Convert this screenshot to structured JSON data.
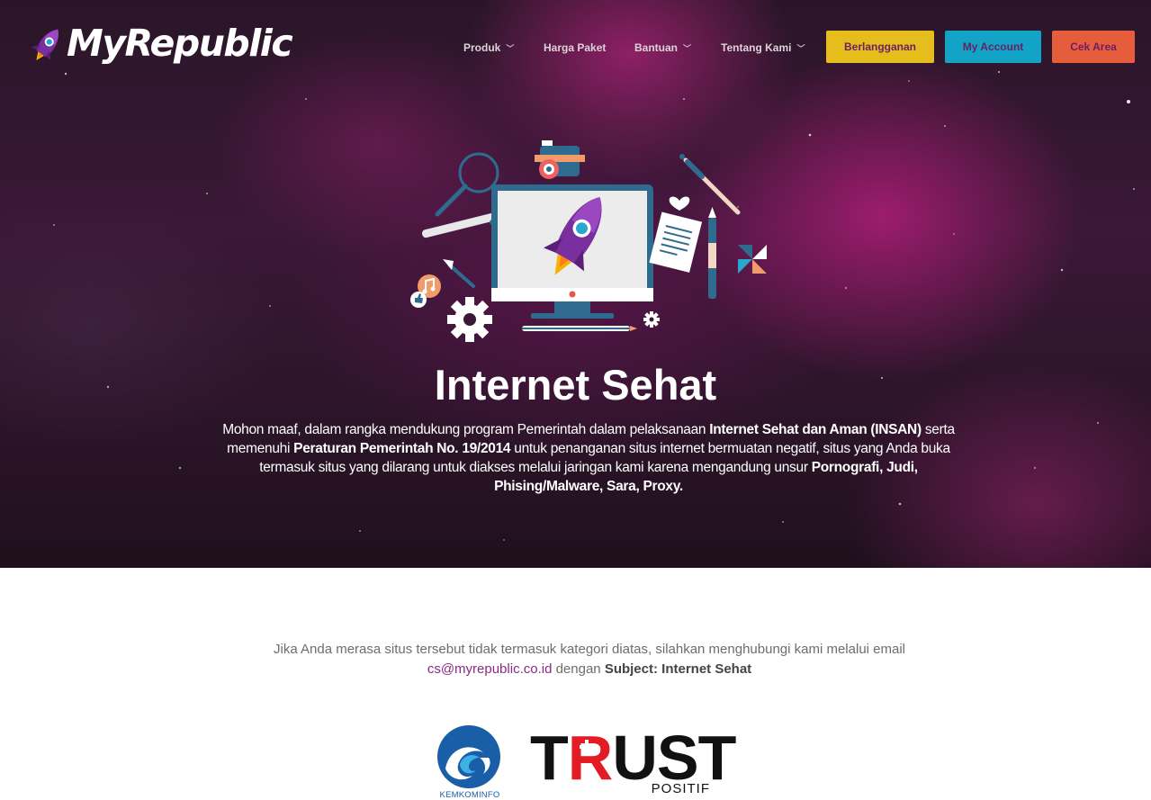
{
  "brand": {
    "name": "MyRepublic"
  },
  "nav": {
    "items": [
      {
        "label": "Produk",
        "has_dropdown": true
      },
      {
        "label": "Harga Paket",
        "has_dropdown": false
      },
      {
        "label": "Bantuan",
        "has_dropdown": true
      },
      {
        "label": "Tentang Kami",
        "has_dropdown": true
      }
    ],
    "buttons": {
      "subscribe": "Berlangganan",
      "account": "My Account",
      "check_area": "Cek Area"
    }
  },
  "hero": {
    "title": "Internet Sehat",
    "paragraph": {
      "t1": "Mohon maaf, dalam rangka mendukung program Pemerintah dalam pelaksanaan ",
      "b1": "Internet Sehat dan Aman (INSAN)",
      "t2": " serta memenuhi ",
      "b2": "Peraturan Pemerintah No. 19/2014",
      "t3": " untuk penanganan situs internet bermuatan negatif, situs yang Anda buka termasuk situs yang dilarang untuk diakses melalui jaringan kami karena mengandung unsur ",
      "b3": "Pornografi, Judi, Phising/Malware, Sara, Proxy."
    }
  },
  "contact": {
    "text1": "Jika Anda merasa situs tersebut tidak termasuk kategori diatas, silahkan menghubungi kami melalui email",
    "email": "cs@myrepublic.co.id",
    "text2": " dengan ",
    "subject": "Subject: Internet Sehat"
  },
  "logos": {
    "kemkominfo": "KEMKOMINFO",
    "trust_word_1": "T",
    "trust_word_r": "R",
    "trust_word_2": "UST",
    "trust_sub": "POSITIF"
  },
  "colors": {
    "button_yellow": "#e5be1e",
    "button_blue": "#12a3c6",
    "button_orange": "#e65d3c",
    "button_text": "#6b1f63",
    "link": "#8b2a84",
    "trust_red": "#e21c24"
  },
  "icons": [
    "rocket-icon",
    "chevron-down-icon",
    "magnifier-icon",
    "camera-icon",
    "monitor-icon",
    "heart-icon",
    "paintbrush-icon",
    "document-icon",
    "gear-icon",
    "music-icon",
    "thumbs-up-icon",
    "pen-nib-icon",
    "pencil-icon",
    "pinwheel-icon"
  ]
}
